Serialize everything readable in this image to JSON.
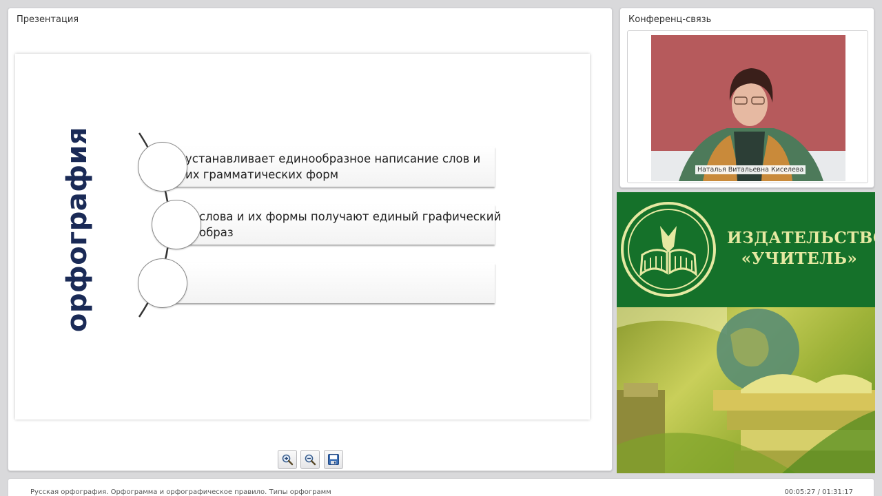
{
  "presentation": {
    "panel_title": "Презентация",
    "slide": {
      "vertical_word": "орфография",
      "items": [
        {
          "text": "устанавливает единообразное написание слов и их грамматических форм"
        },
        {
          "text": "слова и их формы получают единый графический образ"
        },
        {
          "text": ""
        }
      ],
      "accent_color": "#1a2a56"
    },
    "toolbar": {
      "zoom_in": "zoom-in-icon",
      "zoom_out": "zoom-out-icon",
      "save": "save-icon"
    }
  },
  "conference": {
    "panel_title": "Конференц-связь",
    "speaker_name": "Наталья Витальевна Киселева"
  },
  "advert": {
    "publisher_name": "ИЗДАТЕЛЬСТВО «УЧИТЕЛЬ»",
    "brand_green": "#15712a",
    "brand_text": "#e6e9a2"
  },
  "footer": {
    "lesson_title": "Русская орфография. Орфограмма и орфографическое правило. Типы орфограмм",
    "time": "00:05:27 / 01:31:17"
  }
}
